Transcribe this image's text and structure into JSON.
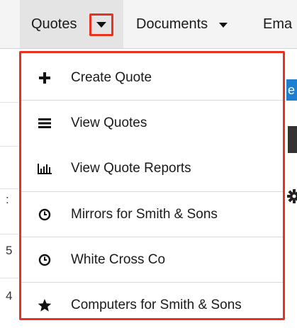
{
  "nav": {
    "tabs": [
      {
        "label": "Quotes",
        "active": true
      },
      {
        "label": "Documents"
      },
      {
        "label": "Ema"
      }
    ]
  },
  "background": {
    "row_chars": [
      ":",
      "5",
      "4"
    ],
    "blue_button_char": "e"
  },
  "menu": {
    "items": [
      {
        "label": "Create Quote",
        "icon": "plus-icon"
      },
      {
        "label": "View Quotes",
        "icon": "list-icon"
      },
      {
        "label": "View Quote Reports",
        "icon": "bar-chart-icon"
      },
      {
        "label": "Mirrors for Smith & Sons",
        "icon": "clock-icon"
      },
      {
        "label": "White Cross Co",
        "icon": "clock-icon"
      },
      {
        "label": "Computers for Smith & Sons",
        "icon": "star-icon"
      }
    ]
  },
  "colors": {
    "highlight": "#e8321e",
    "nav_bg": "#f4f4f4",
    "accent_blue": "#1e7fd0"
  }
}
